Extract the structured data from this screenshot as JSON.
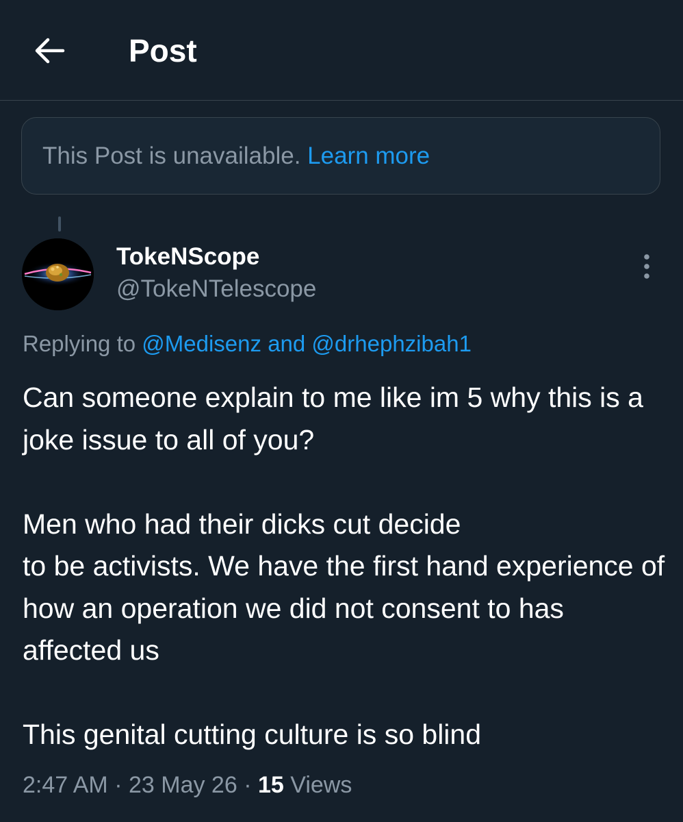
{
  "header": {
    "title": "Post",
    "back_icon": "arrow-left-icon"
  },
  "notice": {
    "text": "This Post is unavailable.",
    "link": "Learn more"
  },
  "author": {
    "name": "TokeNScope",
    "handle": "@TokeNTelescope",
    "avatar_icon": "galaxy-avatar",
    "more_icon": "vertical-ellipsis-icon"
  },
  "reply": {
    "prefix": "Replying to",
    "user1": "@Medisenz",
    "joiner": "and",
    "user2": "@drhephzibah1"
  },
  "post": {
    "text": "Can someone explain to me like im 5 why this is a joke issue to all of you?\n\nMen who had their dicks cut decide\nto be activists. We have the first hand experience of how an operation we did not consent to has affected us\n\nThis genital cutting culture is so blind"
  },
  "meta": {
    "time": "2:47 AM",
    "date": "23 May 26",
    "separator": "·",
    "views_count": "15",
    "views_label": "Views"
  },
  "colors": {
    "background": "#15202b",
    "link": "#1d9bf0",
    "secondary_text": "#8b98a5",
    "border": "#38444d"
  }
}
